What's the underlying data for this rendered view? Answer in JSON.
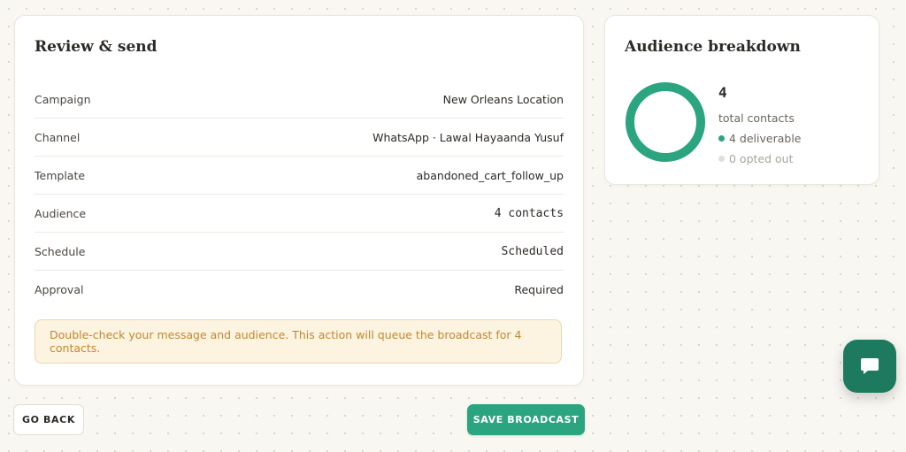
{
  "review": {
    "title": "Review & send",
    "rows": [
      {
        "label": "Campaign",
        "value": "New Orleans Location"
      },
      {
        "label": "Channel",
        "value": "WhatsApp · Lawal Hayaanda Yusuf"
      },
      {
        "label": "Template",
        "value": "abandoned_cart_follow_up"
      },
      {
        "label": "Audience",
        "value": "4 contacts"
      },
      {
        "label": "Schedule",
        "value": "Scheduled"
      },
      {
        "label": "Approval",
        "value": "Required"
      }
    ],
    "notice": "Double-check your message and audience. This action will queue the broadcast for 4 contacts."
  },
  "audience": {
    "title": "Audience breakdown",
    "count": "4",
    "count_label": "total contacts",
    "deliverable": "4 deliverable",
    "opted_out": "0 opted out",
    "deliverable_fraction": 1.0
  },
  "actions": {
    "back_label": "GO BACK",
    "save_label": "SAVE BROADCAST"
  },
  "colors": {
    "accent": "#2aa57f",
    "notice_text": "#c2882f",
    "chat_button": "#1d7a5e"
  },
  "icons": {
    "chat": "chat-bubble-icon"
  }
}
